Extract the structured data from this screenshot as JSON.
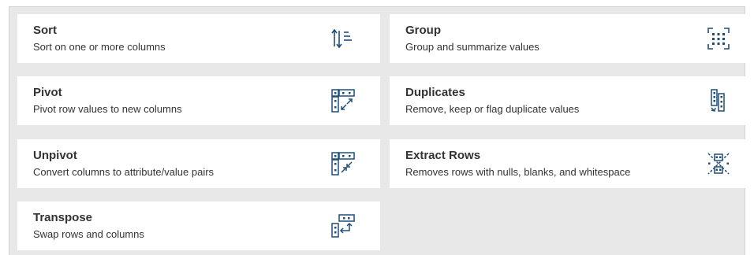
{
  "operations": [
    {
      "title": "Sort",
      "description": "Sort on one or more columns",
      "icon": "sort-icon"
    },
    {
      "title": "Group",
      "description": "Group and summarize values",
      "icon": "group-icon"
    },
    {
      "title": "Pivot",
      "description": "Pivot row values to new columns",
      "icon": "pivot-icon"
    },
    {
      "title": "Duplicates",
      "description": "Remove, keep or flag duplicate values",
      "icon": "duplicates-icon"
    },
    {
      "title": "Unpivot",
      "description": "Convert columns to attribute/value pairs",
      "icon": "unpivot-icon"
    },
    {
      "title": "Extract Rows",
      "description": "Removes rows with nulls, blanks, and whitespace",
      "icon": "extract-rows-icon"
    },
    {
      "title": "Transpose",
      "description": "Swap rows and columns",
      "icon": "transpose-icon"
    }
  ],
  "colors": {
    "icon": "#1f4e79",
    "panel_background": "#e8e8e8",
    "card_background": "#ffffff",
    "text": "#333333"
  }
}
